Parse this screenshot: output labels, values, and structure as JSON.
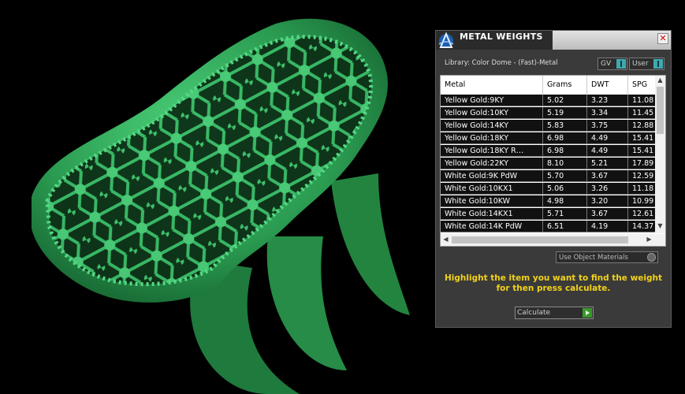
{
  "panel": {
    "title": "METAL WEIGHTS",
    "close_glyph": "✕",
    "library_label": "Library: Color Dome - (Fast)-Metal",
    "toggle_gv": "GV",
    "toggle_user": "User",
    "use_materials_label": "Use Object Materials",
    "instruction_line1": "Highlight the item you want to find the weight",
    "instruction_line2": "for then press calculate.",
    "calculate_label": "Calculate",
    "accent_color": "#f2d21b"
  },
  "table": {
    "columns": [
      "Metal",
      "Grams",
      "DWT",
      "SPG"
    ],
    "rows": [
      [
        "Yellow Gold:9KY",
        "5.02",
        "3.23",
        "11.08"
      ],
      [
        "Yellow Gold:10KY",
        "5.19",
        "3.34",
        "11.45"
      ],
      [
        "Yellow Gold:14KY",
        "5.83",
        "3.75",
        "12.88"
      ],
      [
        "Yellow Gold:18KY",
        "6.98",
        "4.49",
        "15.41"
      ],
      [
        "Yellow Gold:18KY R…",
        "6.98",
        "4.49",
        "15.41"
      ],
      [
        "Yellow Gold:22KY",
        "8.10",
        "5.21",
        "17.89"
      ],
      [
        "White Gold:9K PdW",
        "5.70",
        "3.67",
        "12.59"
      ],
      [
        "White Gold:10KX1",
        "5.06",
        "3.26",
        "11.18"
      ],
      [
        "White Gold:10KW",
        "4.98",
        "3.20",
        "10.99"
      ],
      [
        "White Gold:14KX1",
        "5.71",
        "3.67",
        "12.61"
      ],
      [
        "White Gold:14K PdW",
        "6.51",
        "4.19",
        "14.37"
      ]
    ]
  },
  "viewport": {
    "object": "filigree ring model",
    "color": "#2fa85a"
  }
}
